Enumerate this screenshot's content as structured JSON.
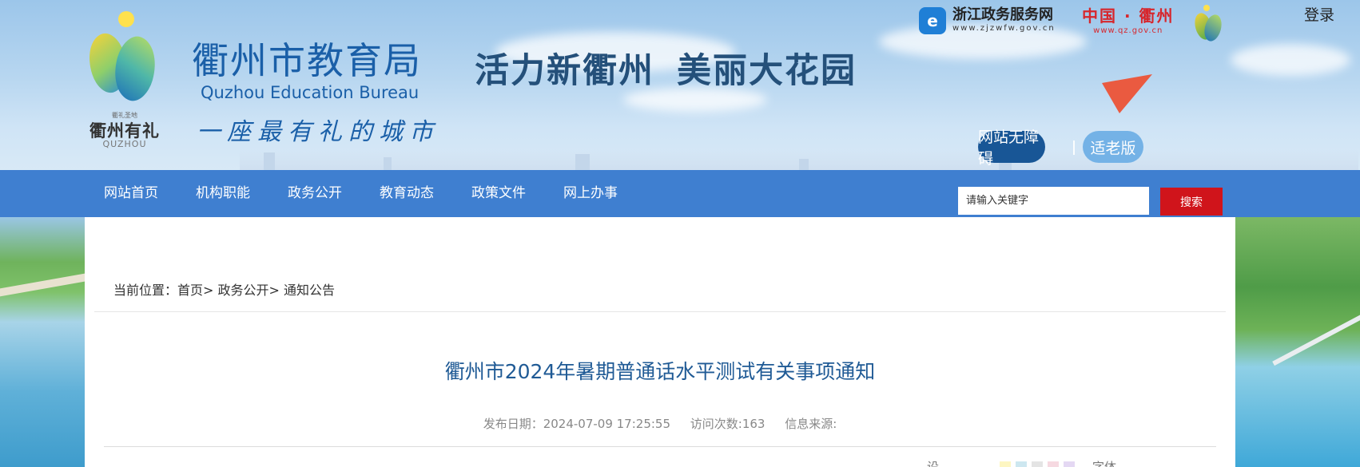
{
  "header": {
    "logo": {
      "small": "衢礼圣地",
      "cn": "衢州有礼",
      "en": "QUZHOU"
    },
    "site_title_cn": "衢州市教育局",
    "site_title_en": "Quzhou Education Bureau",
    "slogan": "一座最有礼的城市",
    "headline_part1": "活力新衢州",
    "headline_part2": "美丽大花园",
    "zjzw": {
      "icon": "e",
      "name": "浙江政务服务网",
      "url": "www.zjzwfw.gov.cn"
    },
    "qzgov": {
      "name": "中国 · 衢州",
      "url": "www.qz.gov.cn"
    },
    "login_label": "登录",
    "accessibility_label": "网站无障碍",
    "elder_label": "适老版"
  },
  "nav": {
    "items": [
      "网站首页",
      "机构职能",
      "政务公开",
      "教育动态",
      "政策文件",
      "网上办事"
    ],
    "search_placeholder": "请输入关键字",
    "search_button": "搜索"
  },
  "content": {
    "breadcrumb": {
      "prefix": "当前位置：",
      "home": "首页",
      "sep1": "> ",
      "section": "政务公开",
      "sep2": "> ",
      "current": "通知公告"
    },
    "title": "衢州市2024年暑期普通话水平测试有关事项通知",
    "meta": {
      "date": "发布日期：2024-07-09 17:25:55",
      "visits": "访问次数:163",
      "source": "信息来源:"
    },
    "tools": {
      "bg_label": "设",
      "font_label": "字体"
    }
  },
  "colors": {
    "nav_bg": "#3f7fd0",
    "search_btn": "#d0141b",
    "title": "#1f5a95",
    "accessibility_btn": "#185696",
    "elder_btn": "#74b2e6",
    "swatches": [
      "#fdf6c2",
      "#cde7f0",
      "#e4e4e4",
      "#f6d9e1",
      "#e4d8f3"
    ]
  }
}
